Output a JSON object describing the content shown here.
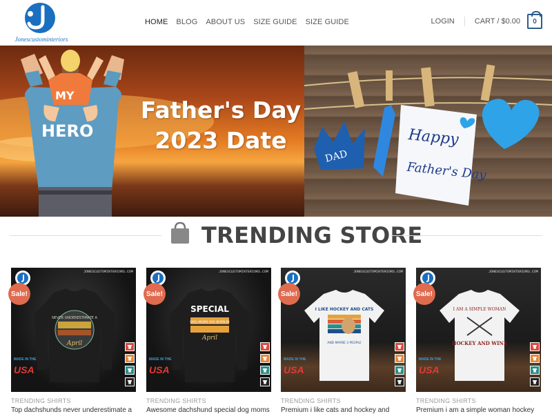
{
  "header": {
    "logo_text": "Jonescustominteriors",
    "nav": [
      "HOME",
      "BLOG",
      "ABOUT US",
      "SIZE GUIDE",
      "SIZE GUIDE"
    ],
    "login": "LOGIN",
    "cart": "CART / $0.00",
    "cart_count": "0"
  },
  "banner": {
    "shirt_line1": "MY",
    "shirt_line2": "HERO",
    "title_line1": "Father's Day",
    "title_line2": "2023 Date",
    "crown_text": "DAD",
    "card_text_1": "Happy",
    "card_text_2": "Father's Day"
  },
  "section": {
    "title": "TRENDING STORE"
  },
  "products": [
    {
      "category": "TRENDING SHIRTS",
      "name": "Top dachshunds never underestimate a",
      "sale": "Sale!",
      "shirt_text": "NEVER UNDERESTIMATE A",
      "shirt_sub": "April",
      "style": "dark"
    },
    {
      "category": "TRENDING SHIRTS",
      "name": "Awesome dachshund special dog moms",
      "sale": "Sale!",
      "shirt_text": "SPECIAL",
      "shirt_sub": "DOG MOMS ARE BORN IN",
      "shirt_sub2": "April",
      "style": "dark"
    },
    {
      "category": "TRENDING SHIRTS",
      "name": "Premium i like cats and hockey and",
      "sale": "Sale!",
      "shirt_text": "I LIKE HOCKEY AND CATS",
      "shirt_sub": "AND MAYBE 3 PEOPLE",
      "style": "light"
    },
    {
      "category": "TRENDING SHIRTS",
      "name": "Premium i am a simple woman hockey",
      "sale": "Sale!",
      "shirt_text": "I AM A SIMPLE WOMAN",
      "shirt_sub": "HOCKEY AND WINE",
      "style": "light"
    }
  ],
  "product_badge": {
    "site": "JONESCUSTOMINTERIORS.COM",
    "made_in": "MADE IN THE",
    "country": "USA"
  },
  "colors": {
    "brand_blue": "#1a6fc0",
    "sale": "#e06b4f",
    "cart_border": "#2b5c8a"
  }
}
